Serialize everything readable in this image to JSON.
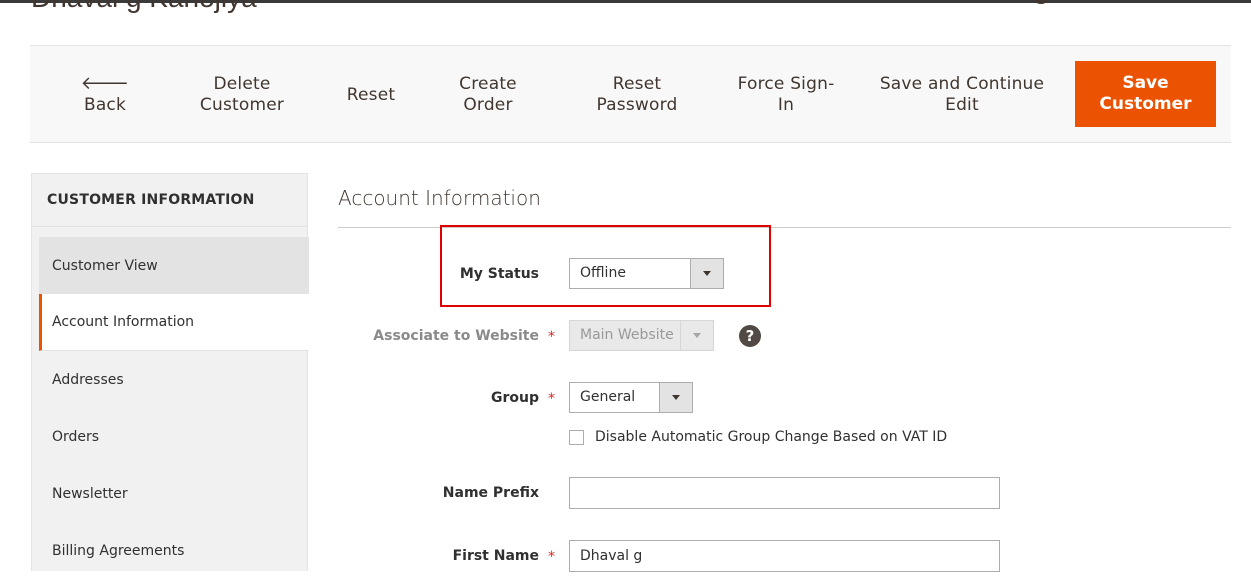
{
  "page": {
    "title": "Dhaval g Kanojiya"
  },
  "header_icons": [
    "search-icon",
    "notifications-icon",
    "user-icon"
  ],
  "actions": {
    "back": "Back",
    "delete_customer": "Delete\nCustomer",
    "reset": "Reset",
    "create_order": "Create\nOrder",
    "reset_password": "Reset\nPassword",
    "force_sign_in": "Force Sign-\nIn",
    "save_continue": "Save and Continue\nEdit",
    "save_customer": "Save\nCustomer"
  },
  "sidebar": {
    "title": "CUSTOMER INFORMATION",
    "items": [
      {
        "label": "Customer View"
      },
      {
        "label": "Account Information"
      },
      {
        "label": "Addresses"
      },
      {
        "label": "Orders"
      },
      {
        "label": "Newsletter"
      },
      {
        "label": "Billing Agreements"
      }
    ]
  },
  "form": {
    "section_title": "Account Information",
    "my_status": {
      "label": "My Status",
      "value": "Offline"
    },
    "website": {
      "label": "Associate to Website",
      "value": "Main Website",
      "required_mark": "*"
    },
    "group": {
      "label": "Group",
      "value": "General",
      "required_mark": "*"
    },
    "disable_group_change": {
      "label": "Disable Automatic Group Change Based on VAT ID",
      "checked": false
    },
    "name_prefix": {
      "label": "Name Prefix",
      "value": ""
    },
    "first_name": {
      "label": "First Name",
      "value": "Dhaval g",
      "required_mark": "*"
    }
  },
  "colors": {
    "accent": "#eb5202",
    "highlight": "#e00000",
    "required": "#e22626"
  }
}
